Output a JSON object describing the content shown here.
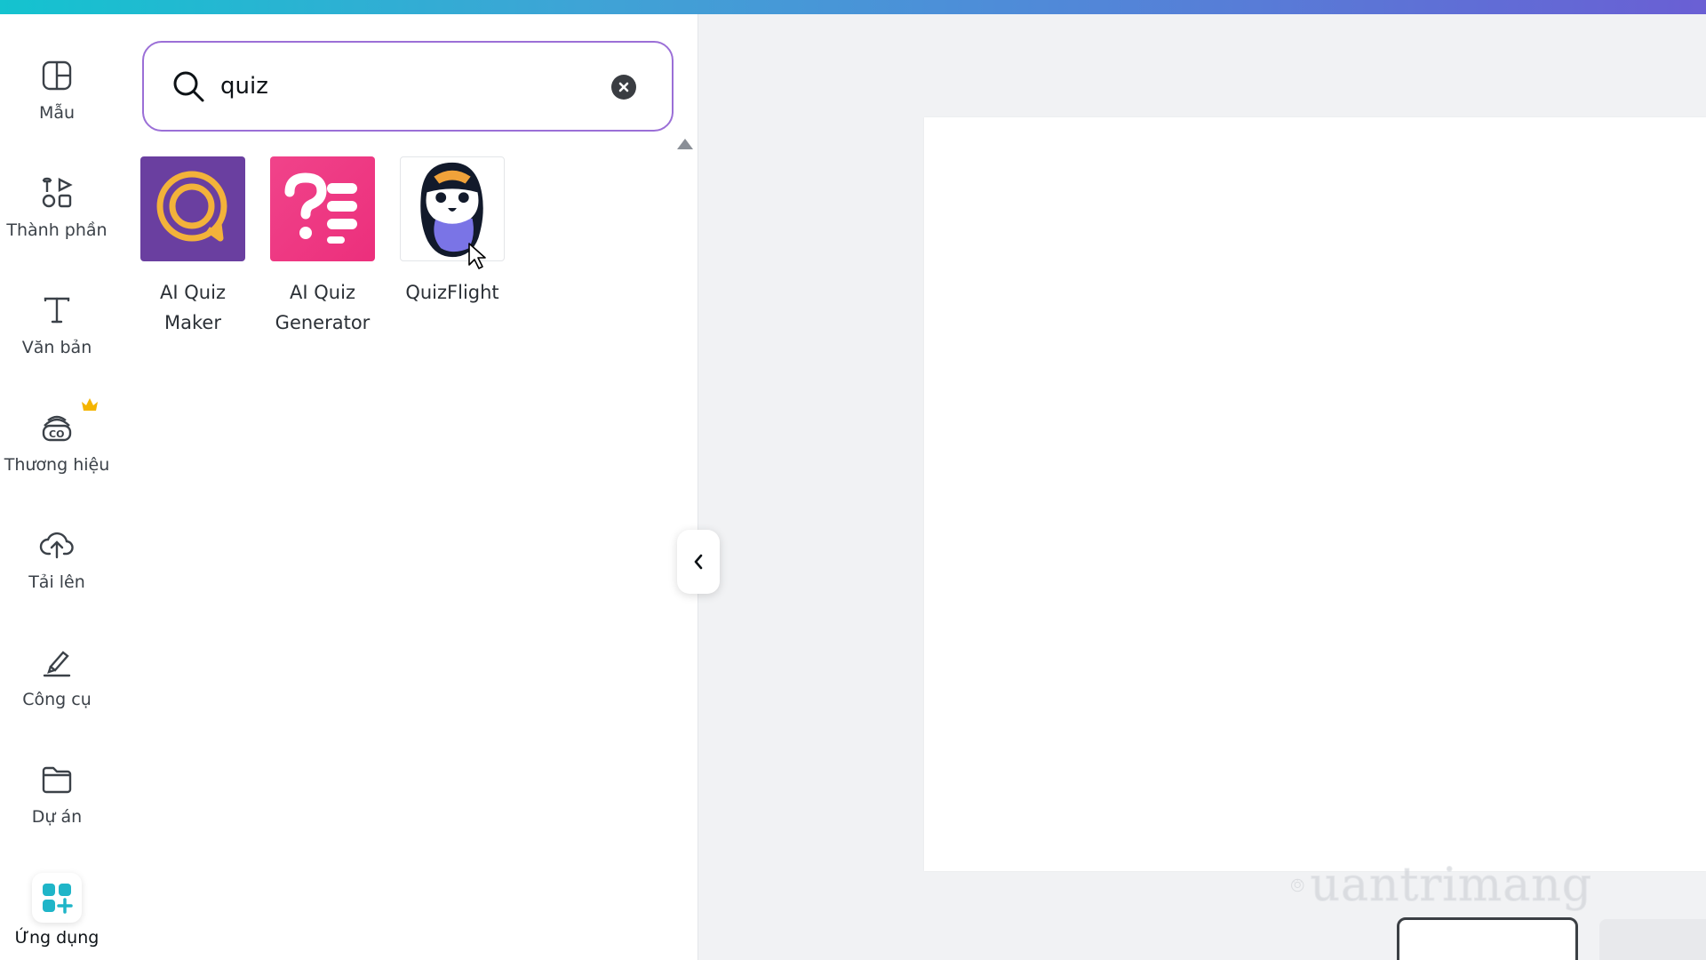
{
  "rail": {
    "items": [
      {
        "label": "Mẫu",
        "icon": "template-icon"
      },
      {
        "label": "Thành phần",
        "icon": "elements-icon"
      },
      {
        "label": "Văn bản",
        "icon": "text-icon"
      },
      {
        "label": "Thương hiệu",
        "icon": "brand-icon",
        "premium": true
      },
      {
        "label": "Tải lên",
        "icon": "upload-icon"
      },
      {
        "label": "Công cụ",
        "icon": "tools-icon"
      },
      {
        "label": "Dự án",
        "icon": "folder-icon"
      },
      {
        "label": "Ứng dụng",
        "icon": "apps-icon",
        "active": true
      }
    ]
  },
  "search": {
    "value": "quiz"
  },
  "apps": [
    {
      "name": "AI Quiz Maker",
      "line1": "AI Quiz",
      "line2": "Maker",
      "color": "#6a3fa0"
    },
    {
      "name": "AI Quiz Generator",
      "line1": "AI Quiz",
      "line2": "Generator",
      "color": "#ee3f86"
    },
    {
      "name": "QuizFlight",
      "line1": "QuizFlight",
      "line2": "",
      "color": "#ffffff"
    }
  ],
  "watermark": {
    "text": "uantrimang"
  },
  "colors": {
    "accent": "#9b6fd7",
    "apps_active": "#1fb5c8"
  }
}
